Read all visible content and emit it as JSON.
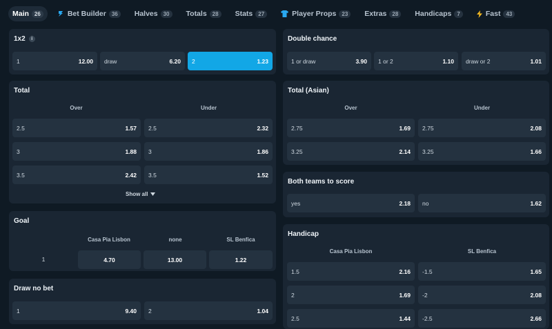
{
  "tabs": [
    {
      "label": "Main",
      "count": "26"
    },
    {
      "label": "Bet Builder",
      "count": "36"
    },
    {
      "label": "Halves",
      "count": "30"
    },
    {
      "label": "Totals",
      "count": "28"
    },
    {
      "label": "Stats",
      "count": "27"
    },
    {
      "label": "Player Props",
      "count": "23"
    },
    {
      "label": "Extras",
      "count": "28"
    },
    {
      "label": "Handicaps",
      "count": "7"
    },
    {
      "label": "Fast",
      "count": "43"
    }
  ],
  "colors": {
    "accent": "#12a7e6",
    "card": "#1a2633",
    "button": "#243240",
    "bolt": "#f5b921",
    "builder": "#29a8f0"
  },
  "market_1x2": {
    "title": "1x2",
    "info": "i",
    "options": [
      {
        "label": "1",
        "odd": "12.00"
      },
      {
        "label": "draw",
        "odd": "6.20"
      },
      {
        "label": "2",
        "odd": "1.23",
        "selected": true
      }
    ]
  },
  "double_chance": {
    "title": "Double chance",
    "options": [
      {
        "label": "1 or draw",
        "odd": "3.90"
      },
      {
        "label": "1 or 2",
        "odd": "1.10"
      },
      {
        "label": "draw or 2",
        "odd": "1.01"
      }
    ]
  },
  "total": {
    "title": "Total",
    "over": "Over",
    "under": "Under",
    "rows": [
      {
        "line": "2.5",
        "over": "1.57",
        "under": "2.32"
      },
      {
        "line": "3",
        "over": "1.88",
        "under": "1.86"
      },
      {
        "line": "3.5",
        "over": "2.42",
        "under": "1.52"
      }
    ],
    "show_all": "Show all"
  },
  "total_asian": {
    "title": "Total (Asian)",
    "over": "Over",
    "under": "Under",
    "rows": [
      {
        "line": "2.75",
        "over": "1.69",
        "under": "2.08"
      },
      {
        "line": "3.25",
        "over": "2.14",
        "under": "1.66"
      }
    ]
  },
  "btts": {
    "title": "Both teams to score",
    "options": [
      {
        "label": "yes",
        "odd": "2.18"
      },
      {
        "label": "no",
        "odd": "1.62"
      }
    ]
  },
  "goal": {
    "title": "Goal",
    "headers": [
      "Casa Pia Lisbon",
      "none",
      "SL Benfica"
    ],
    "row_label": "1",
    "odds": [
      "4.70",
      "13.00",
      "1.22"
    ]
  },
  "handicap": {
    "title": "Handicap",
    "headers": [
      "Casa Pia Lisbon",
      "SL Benfica"
    ],
    "rows": [
      {
        "home_line": "1.5",
        "home_odd": "2.16",
        "away_line": "-1.5",
        "away_odd": "1.65"
      },
      {
        "home_line": "2",
        "home_odd": "1.69",
        "away_line": "-2",
        "away_odd": "2.08"
      },
      {
        "home_line": "2.5",
        "home_odd": "1.44",
        "away_line": "-2.5",
        "away_odd": "2.66"
      }
    ]
  },
  "draw_no_bet": {
    "title": "Draw no bet",
    "options": [
      {
        "label": "1",
        "odd": "9.40"
      },
      {
        "label": "2",
        "odd": "1.04"
      }
    ]
  }
}
